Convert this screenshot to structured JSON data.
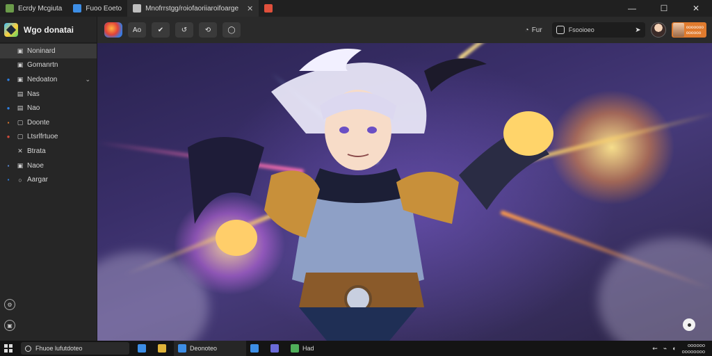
{
  "tabs": [
    {
      "label": "Ecrdy Mcgiuta",
      "icon_color": "#6b9b4a",
      "active": false
    },
    {
      "label": "Fuoo Eoeto",
      "icon_color": "#3d8ee6",
      "active": false
    },
    {
      "label": "Mnofrrstgg/roiofaoriiaroifoarge",
      "icon_color": "#bfbfbf",
      "active": true
    },
    {
      "label": "",
      "icon_color": "#e0503c",
      "active": false
    }
  ],
  "tab_close_glyph": "✕",
  "window_controls": {
    "minimize": "—",
    "maximize": "☐",
    "close": "✕"
  },
  "app": {
    "title": "Wgo donatai"
  },
  "sidebar": {
    "items": [
      {
        "label": "Noninard",
        "lead": "⌂",
        "lead_color": "transparent",
        "sub": "▣",
        "selected": true
      },
      {
        "label": "Gomanrtn",
        "lead": "",
        "lead_color": "transparent",
        "sub": "▣",
        "selected": false
      },
      {
        "label": "Nedoaton",
        "lead": "●",
        "lead_color": "#2f7fe0",
        "sub": "▣",
        "selected": false,
        "caret": "⌄"
      },
      {
        "label": "Nas",
        "lead": "",
        "lead_color": "transparent",
        "sub": "▤",
        "selected": false
      },
      {
        "label": "Nao",
        "lead": "●",
        "lead_color": "#2f7fe0",
        "sub": "▤",
        "selected": false
      },
      {
        "label": "Doonte",
        "lead": "▪",
        "lead_color": "#e07b2e",
        "sub": "▢",
        "selected": false
      },
      {
        "label": "Ltsrlfrtuoe",
        "lead": "●",
        "lead_color": "#d04a3a",
        "sub": "▢",
        "selected": false
      },
      {
        "label": "Btrata",
        "lead": "",
        "lead_color": "transparent",
        "sub": "✕",
        "selected": false
      },
      {
        "label": "Naoe",
        "lead": "▪",
        "lead_color": "#5a8ad6",
        "sub": "▣",
        "selected": false
      },
      {
        "label": "Aargar",
        "lead": "▪",
        "lead_color": "#2f7fe0",
        "sub": "○",
        "selected": false
      }
    ]
  },
  "toolbar": {
    "buttons": [
      "",
      "Ao",
      "✔",
      "↺",
      "⟲",
      "◯"
    ],
    "status": {
      "icon": "◔",
      "text": "Fur"
    },
    "search": {
      "placeholder": "Fsooioeo",
      "send": "➤"
    },
    "profile": {
      "line1": "ooooooo",
      "line2": "oooooo"
    }
  },
  "taskbar": {
    "search_text": "Fhuoe lufutdoteo",
    "apps": [
      {
        "label": "",
        "icon_color": "#3d8ee6",
        "wide": false
      },
      {
        "label": "",
        "icon_color": "#e0b43a",
        "wide": false
      },
      {
        "label": "Deonoteo",
        "icon_color": "#3d8ee6",
        "wide": true
      },
      {
        "label": "",
        "icon_color": "#3d8ee6",
        "wide": false
      },
      {
        "label": "",
        "icon_color": "#6b6bd8",
        "wide": false
      },
      {
        "label": "Had",
        "icon_color": "#4fae5a",
        "wide": false
      }
    ],
    "tray_icons": [
      "⇜",
      "⌁",
      "◐"
    ],
    "clock_time": "oooooo",
    "clock_date": "oooooooo"
  }
}
